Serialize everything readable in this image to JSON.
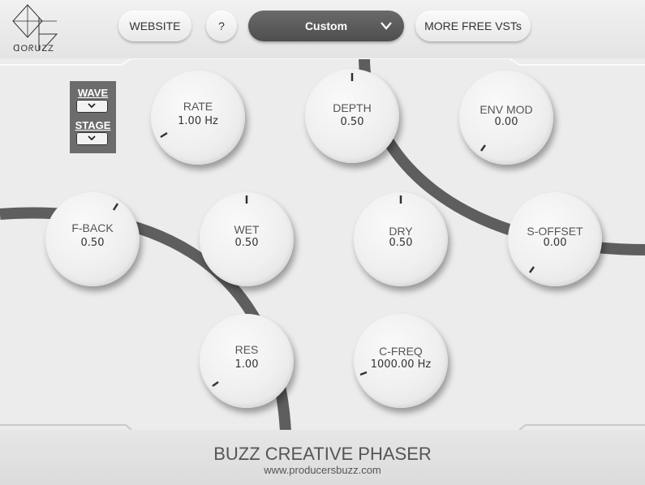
{
  "brand": {
    "logo_text": "ᗡOᖇUZZ"
  },
  "header": {
    "website_label": "WEBSITE",
    "help_label": "?",
    "preset_value": "Custom",
    "more_label": "MORE FREE VSTs"
  },
  "selectors": {
    "wave_label": "WAVE",
    "stage_label": "STAGE"
  },
  "knobs": {
    "rate": {
      "label": "RATE",
      "value": "1.00 Hz"
    },
    "depth": {
      "label": "DEPTH",
      "value": "0.50"
    },
    "envmod": {
      "label": "ENV MOD",
      "value": "0.00"
    },
    "fback": {
      "label": "F-BACK",
      "value": "0.50"
    },
    "wet": {
      "label": "WET",
      "value": "0.50"
    },
    "dry": {
      "label": "DRY",
      "value": "0.50"
    },
    "soffset": {
      "label": "S-OFFSET",
      "value": "0.00"
    },
    "res": {
      "label": "RES",
      "value": "1.00"
    },
    "cfreq": {
      "label": "C-FREQ",
      "value": "1000.00 Hz"
    }
  },
  "footer": {
    "title": "BUZZ CREATIVE PHASER",
    "url": "www.producersbuzz.com"
  },
  "colors": {
    "accent_dark": "#5b5b5b",
    "panel": "#ececec"
  }
}
